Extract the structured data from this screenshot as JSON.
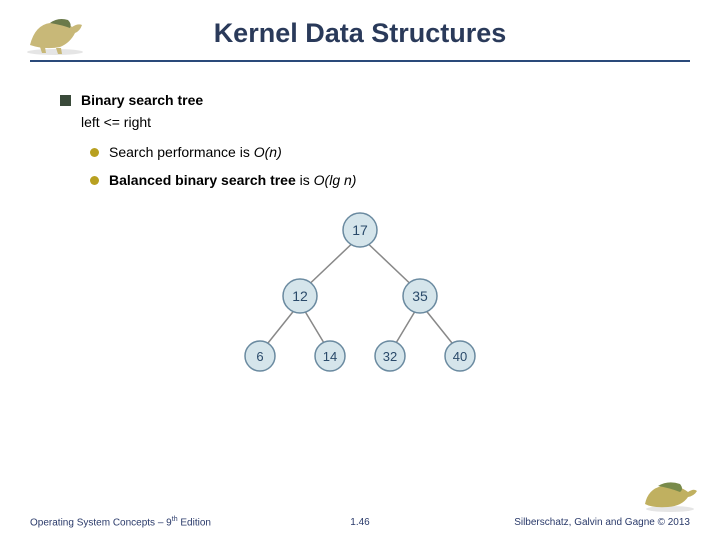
{
  "title": "Kernel Data Structures",
  "bullets": {
    "main": "Binary search tree",
    "sub": "left <= right",
    "items": [
      {
        "prefix": "Search performance is ",
        "ital": "O(n)"
      },
      {
        "bold": "Balanced binary search tree",
        "rest": " is ",
        "ital": "O(lg n)"
      }
    ]
  },
  "chart_data": {
    "type": "tree",
    "root": 17,
    "edges": [
      [
        17,
        12
      ],
      [
        17,
        35
      ],
      [
        12,
        6
      ],
      [
        12,
        14
      ],
      [
        35,
        32
      ],
      [
        35,
        40
      ]
    ],
    "levels": [
      [
        17
      ],
      [
        12,
        35
      ],
      [
        6,
        14,
        32,
        40
      ]
    ]
  },
  "footer": {
    "left_a": "Operating System Concepts – 9",
    "left_sup": "th",
    "left_b": " Edition",
    "center": "1.46",
    "right": "Silberschatz, Galvin and Gagne © 2013"
  }
}
